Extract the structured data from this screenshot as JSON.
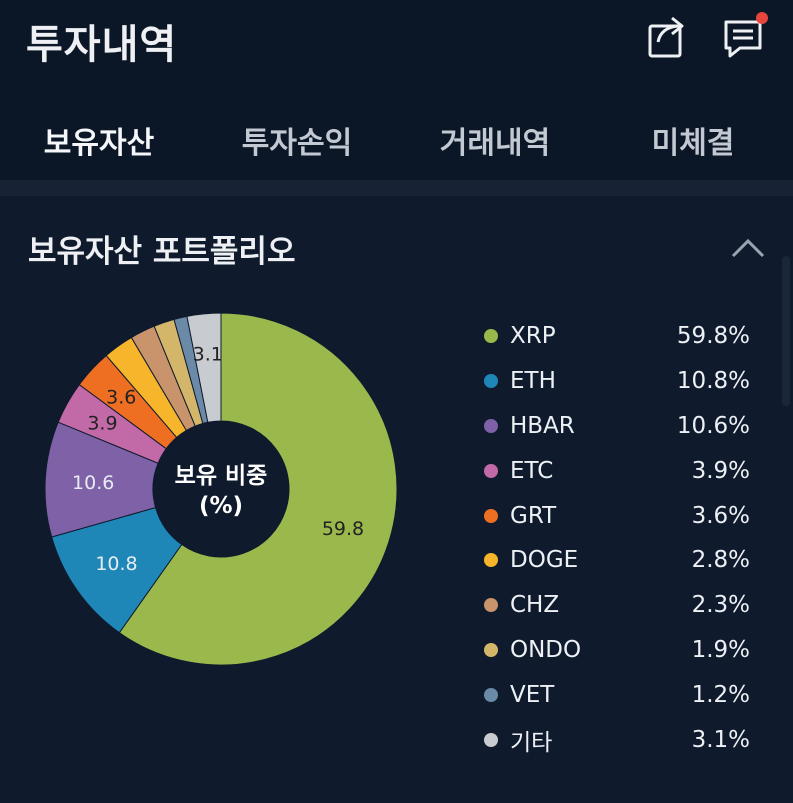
{
  "header": {
    "title": "투자내역",
    "share_icon": "share-icon",
    "notes_icon": "notes-icon",
    "notification_color": "#e8453c"
  },
  "tabs": [
    {
      "label": "보유자산",
      "active": true
    },
    {
      "label": "투자손익",
      "active": false
    },
    {
      "label": "거래내역",
      "active": false
    },
    {
      "label": "미체결",
      "active": false
    }
  ],
  "section": {
    "title": "보유자산 포트폴리오",
    "collapse_icon": "chevron-up-icon"
  },
  "chart_data": {
    "type": "pie",
    "title": "",
    "center_label": [
      "보유 비중",
      "(%)"
    ],
    "categories": [
      "XRP",
      "ETH",
      "HBAR",
      "ETC",
      "GRT",
      "DOGE",
      "CHZ",
      "ONDO",
      "VET",
      "기타"
    ],
    "values": [
      59.8,
      10.8,
      10.6,
      3.9,
      3.6,
      2.8,
      2.3,
      1.9,
      1.2,
      3.1
    ],
    "slice_labels": [
      "59.8",
      "10.8",
      "10.6",
      "3.9",
      "3.6",
      "",
      "",
      "",
      "",
      "3.1"
    ],
    "colors": [
      "#9bb84c",
      "#1f86b8",
      "#7e61a6",
      "#c26aa7",
      "#ef6f22",
      "#f6b52b",
      "#c9946c",
      "#d3b66a",
      "#6b8aa7",
      "#c8ccd1"
    ],
    "legend": "right"
  },
  "legend": [
    {
      "name": "XRP",
      "value": "59.8%",
      "color": "#9bb84c"
    },
    {
      "name": "ETH",
      "value": "10.8%",
      "color": "#1f86b8"
    },
    {
      "name": "HBAR",
      "value": "10.6%",
      "color": "#7e61a6"
    },
    {
      "name": "ETC",
      "value": "3.9%",
      "color": "#c26aa7"
    },
    {
      "name": "GRT",
      "value": "3.6%",
      "color": "#ef6f22"
    },
    {
      "name": "DOGE",
      "value": "2.8%",
      "color": "#f6b52b"
    },
    {
      "name": "CHZ",
      "value": "2.3%",
      "color": "#c9946c"
    },
    {
      "name": "ONDO",
      "value": "1.9%",
      "color": "#d3b66a"
    },
    {
      "name": "VET",
      "value": "1.2%",
      "color": "#6b8aa7"
    },
    {
      "name": "기타",
      "value": "3.1%",
      "color": "#c8ccd1"
    }
  ]
}
